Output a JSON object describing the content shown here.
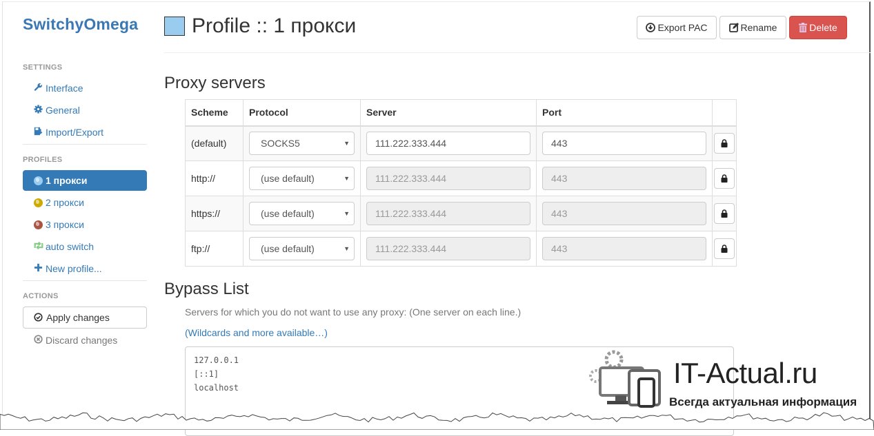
{
  "app": {
    "brand": "SwitchyOmega"
  },
  "sidebar": {
    "settings_header": "SETTINGS",
    "settings_items": [
      {
        "label": "Interface",
        "icon": "wrench-icon"
      },
      {
        "label": "General",
        "icon": "gear-icon"
      },
      {
        "label": "Import/Export",
        "icon": "import-export-icon"
      }
    ],
    "profiles_header": "PROFILES",
    "profiles": [
      {
        "label": "1 прокси",
        "icon": "globe-icon",
        "color": "#99ccee",
        "active": true
      },
      {
        "label": "2 прокси",
        "icon": "globe-icon",
        "color": "#ccaa00",
        "active": false
      },
      {
        "label": "3 прокси",
        "icon": "globe-icon",
        "color": "#aa5544",
        "active": false
      },
      {
        "label": "auto switch",
        "icon": "retweet-icon",
        "color": "#99dd99",
        "active": false
      },
      {
        "label": "New profile...",
        "icon": "plus-icon",
        "active": false
      }
    ],
    "actions_header": "ACTIONS",
    "apply_label": "Apply changes",
    "discard_label": "Discard changes"
  },
  "header": {
    "title": "Profile :: 1 прокси",
    "profile_color": "#99ccee",
    "export_pac_label": "Export PAC",
    "rename_label": "Rename",
    "delete_label": "Delete"
  },
  "proxy_servers": {
    "title": "Proxy servers",
    "columns": [
      "Scheme",
      "Protocol",
      "Server",
      "Port",
      ""
    ],
    "rows": [
      {
        "scheme": "(default)",
        "protocol": "SOCKS5",
        "server": "111.222.333.444",
        "port": "443",
        "disabled": false
      },
      {
        "scheme": "http://",
        "protocol": "(use default)",
        "server": "111.222.333.444",
        "port": "443",
        "disabled": true
      },
      {
        "scheme": "https://",
        "protocol": "(use default)",
        "server": "111.222.333.444",
        "port": "443",
        "disabled": true
      },
      {
        "scheme": "ftp://",
        "protocol": "(use default)",
        "server": "111.222.333.444",
        "port": "443",
        "disabled": true
      }
    ]
  },
  "bypass": {
    "title": "Bypass List",
    "help": "Servers for which you do not want to use any proxy: (One server on each line.)",
    "link": "(Wildcards and more available…)",
    "value": "127.0.0.1\n[::1]\nlocalhost"
  },
  "watermark": {
    "title": "IT-Actual.ru",
    "subtitle": "Всегда актуальная информация"
  }
}
